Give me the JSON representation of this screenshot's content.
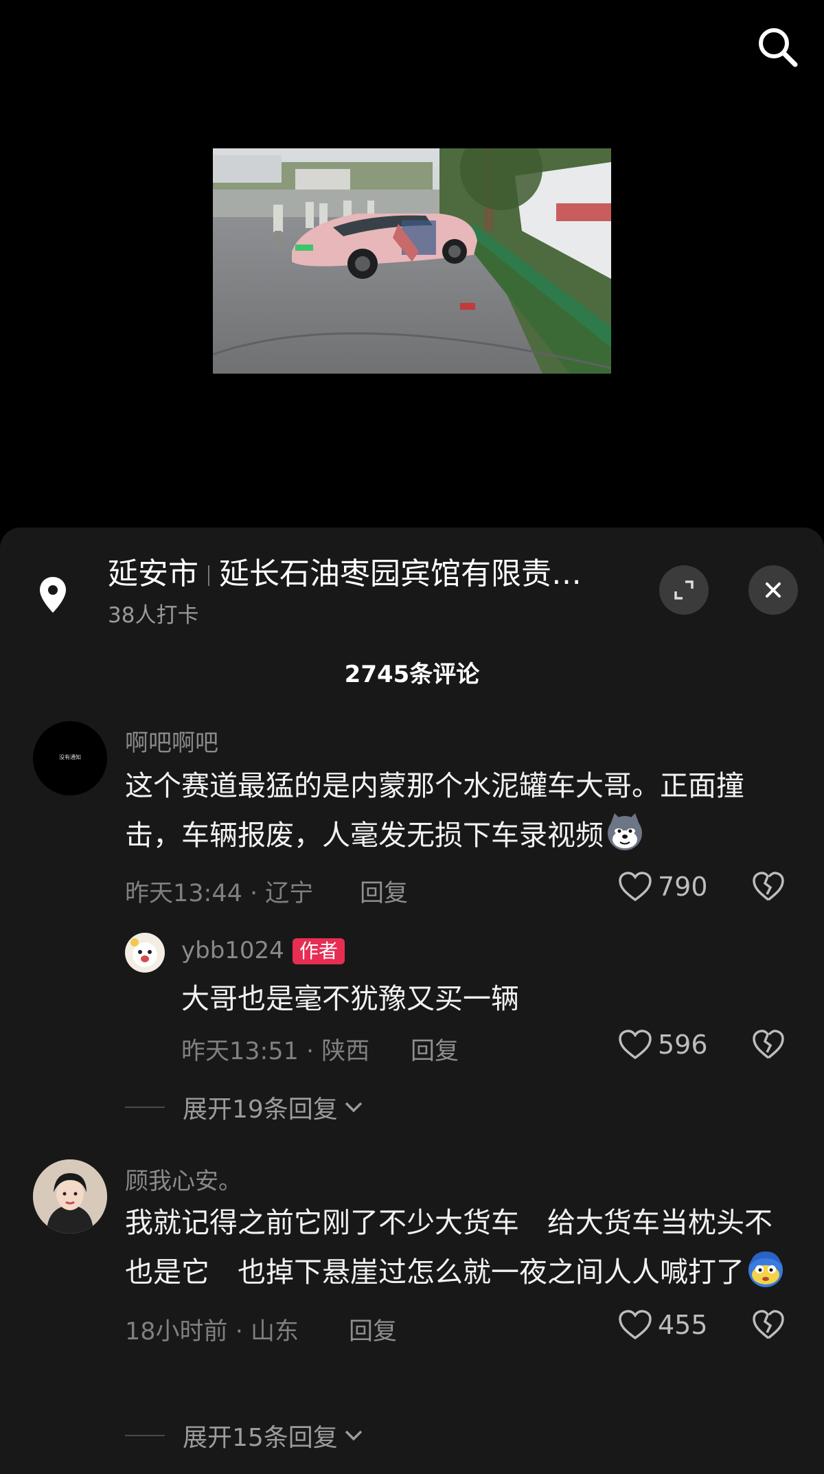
{
  "location": {
    "city": "延安市",
    "place": "延长石油枣园宾馆有限责…",
    "checkins": "38人打卡"
  },
  "comment_count": "2745条评论",
  "comments": [
    {
      "username": "啊吧啊吧",
      "avatar_text": "没有通知",
      "text": "这个赛道最猛的是内蒙那个水泥罐车大哥。正面撞击，车辆报废，人毫发无损下车录视频",
      "time": "昨天13:44",
      "region": "辽宁",
      "reply_label": "回复",
      "likes": "790",
      "reply": {
        "username": "ybb1024",
        "badge": "作者",
        "text": "大哥也是毫不犹豫又买一辆",
        "time": "昨天13:51",
        "region": "陕西",
        "reply_label": "回复",
        "likes": "596"
      },
      "expand": "展开19条回复"
    },
    {
      "username": "顾我心安。",
      "text": "我就记得之前它刚了不少大货车　给大货车当枕头不也是它　也掉下悬崖过怎么就一夜之间人人喊打了",
      "time": "18小时前",
      "region": "山东",
      "reply_label": "回复",
      "likes": "455",
      "expand": "展开15条回复"
    }
  ],
  "separator": "·",
  "colors": {
    "background": "#000000",
    "sheet": "#181818",
    "author_badge": "#e62e53",
    "muted_text": "#808080"
  },
  "icons": [
    "search-icon",
    "location-pin-icon",
    "expand-icon",
    "close-icon",
    "heart-icon",
    "broken-heart-icon",
    "chevron-down-icon"
  ]
}
